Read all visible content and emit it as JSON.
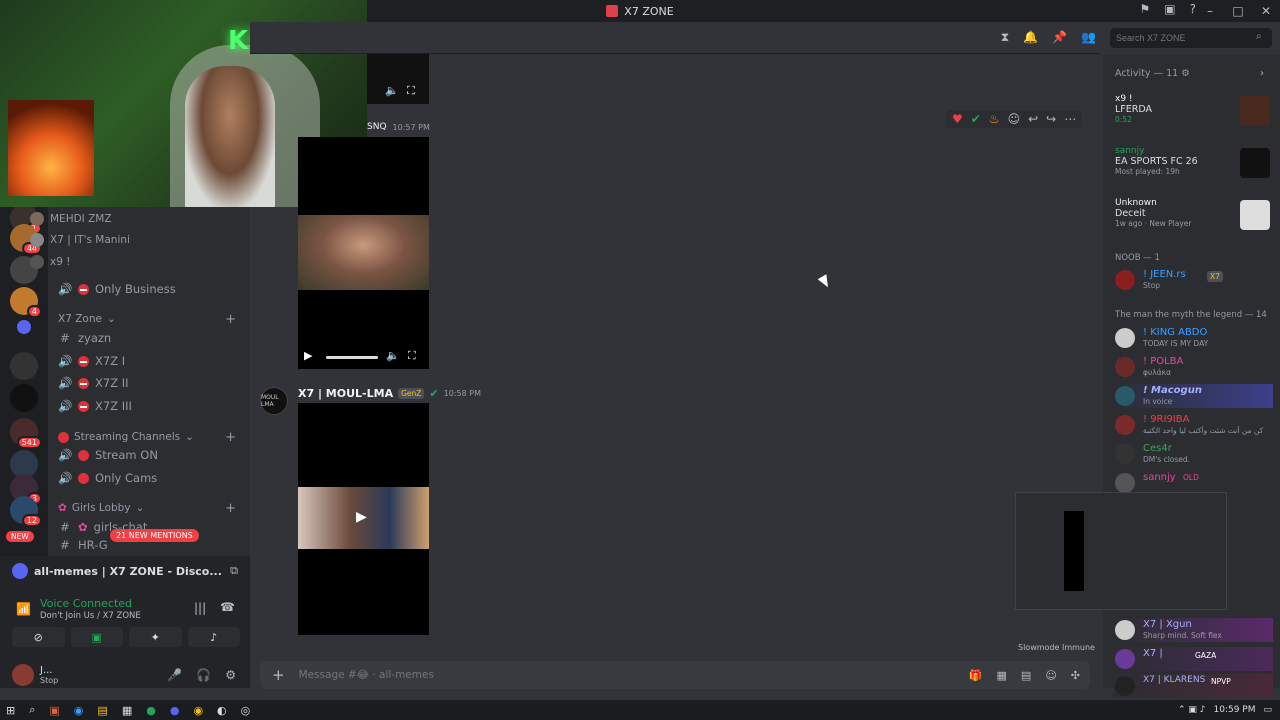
{
  "window": {
    "title": "X7 ZONE"
  },
  "search": {
    "placeholder": "Search X7 ZONE"
  },
  "channels": {
    "voice_users": [
      "MEHDI ZMZ",
      "X7 | IT's Manini",
      "x9 !"
    ],
    "only_business": "Only Business",
    "x7zone_category": "X7 Zone",
    "zyazn": "zyazn",
    "x7z1": "X7Z I",
    "x7z2": "X7Z II",
    "x7z3": "X7Z III",
    "streaming_category": "Streaming Channels",
    "stream_on": "Stream ON",
    "only_cams": "Only Cams",
    "girls_category": "Girls Lobby",
    "girls_chat": "girls-chat",
    "hr": "HR-G"
  },
  "badges": {
    "new": "NEW",
    "mentions": "21 NEW MENTIONS"
  },
  "servers_badges": [
    "1",
    "44",
    "4",
    "541",
    "3",
    "12"
  ],
  "panel": {
    "activity_text": "all-memes | X7 ZONE - Disco...",
    "voice_connected": "Voice Connected",
    "voice_sub": "Don't Join Us / X7 ZONE",
    "user_name": "J...",
    "user_status": "Stop"
  },
  "messages": {
    "first_author": "SNQ",
    "first_time": "10:57 PM",
    "second_author": "X7 | MOUL-LMA",
    "second_tag": "GenZ",
    "second_time": "10:58 PM",
    "avatar_text": "MOUL LMA"
  },
  "composer": {
    "placeholder": "Message #😂 · all-memes",
    "slowmode": "Slowmode Immune"
  },
  "members": {
    "activity_title": "Activity — 11",
    "activities": [
      {
        "name": "x9 !",
        "title": "LFERDA",
        "sub": "0:52"
      },
      {
        "name": "sannjy",
        "title": "EA SPORTS FC 26",
        "sub": "Most played: 19h"
      },
      {
        "name": "Unknown",
        "title": "Deceit",
        "sub": "1w ago · New Player"
      }
    ],
    "noob_header": "NOOB — 1",
    "jeen": {
      "name": "! JEEN.rs",
      "tag": "X7",
      "status": "Stop"
    },
    "legend_header": "The man the myth the legend — 14",
    "list": [
      {
        "name": "! KING ABDO",
        "status": "TODAY IS MY DAY",
        "color": "#3aa0ff"
      },
      {
        "name": "! POLBA",
        "status": "φυλάκα",
        "color": "#eb459e"
      },
      {
        "name": "! Macogun",
        "status": "In voice",
        "color": "#5865f2"
      },
      {
        "name": "! 9RI9IBA",
        "status": "كن من أنت شئت وأكتب ليا واحد الكتبة",
        "color": "#f23f43"
      },
      {
        "name": "Ces4r",
        "status": "DM's closed.",
        "color": "#3ba55c"
      },
      {
        "name": "sannjy",
        "status": "OLD",
        "color": "#eb459e"
      }
    ],
    "bottom": [
      {
        "name": "X7 | Xgun",
        "status": "Sharp mind. Soft flex"
      },
      {
        "name": "X7 |",
        "status": "GAZA"
      },
      {
        "name": "X7 | KLARENS",
        "status": "NPVP"
      }
    ]
  },
  "taskbar": {
    "clock": "10:59 PM"
  }
}
